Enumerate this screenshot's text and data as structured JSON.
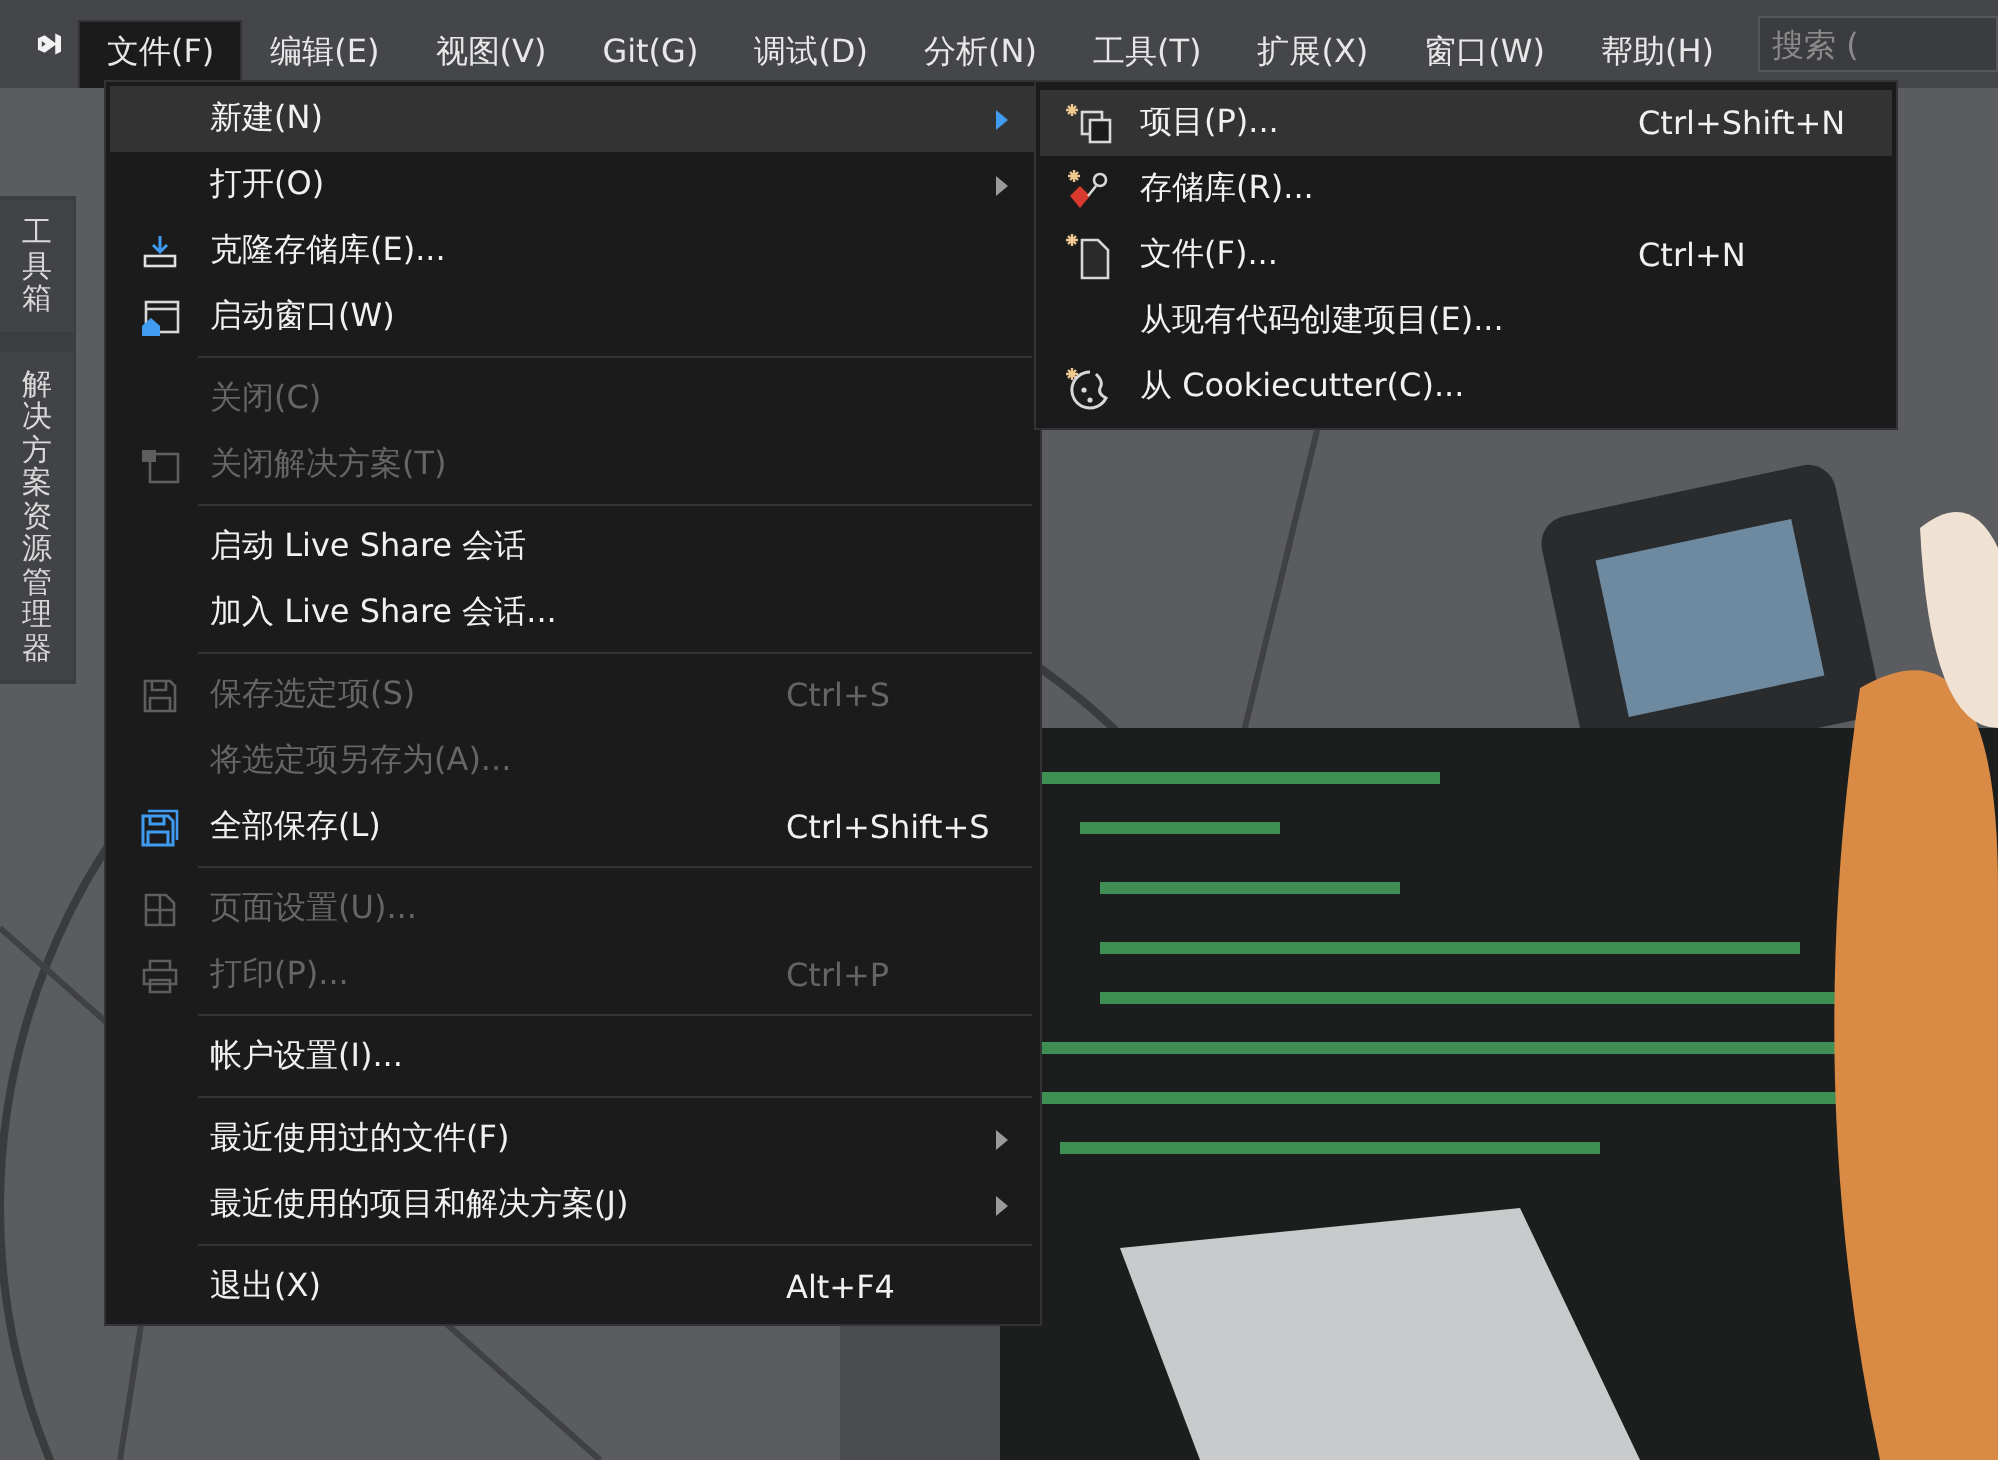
{
  "menu_bar": {
    "items": [
      {
        "label": "文件(F)",
        "selected": true
      },
      {
        "label": "编辑(E)",
        "selected": false
      },
      {
        "label": "视图(V)",
        "selected": false
      },
      {
        "label": "Git(G)",
        "selected": false
      },
      {
        "label": "调试(D)",
        "selected": false
      },
      {
        "label": "分析(N)",
        "selected": false
      },
      {
        "label": "工具(T)",
        "selected": false
      },
      {
        "label": "扩展(X)",
        "selected": false
      },
      {
        "label": "窗口(W)",
        "selected": false
      },
      {
        "label": "帮助(H)",
        "selected": false
      }
    ],
    "search": {
      "placeholder": "搜索 ("
    }
  },
  "side_tabs": [
    "工具箱",
    "解决方案资源管理器"
  ],
  "file_menu": {
    "items": [
      {
        "kind": "item",
        "label": "新建(N)",
        "selected": true,
        "disabled": false,
        "submenu": true
      },
      {
        "kind": "item",
        "label": "打开(O)",
        "selected": false,
        "disabled": false,
        "submenu": true
      },
      {
        "kind": "item",
        "label": "克隆存储库(E)...",
        "selected": false,
        "disabled": false,
        "submenu": false
      },
      {
        "kind": "item",
        "label": "启动窗口(W)",
        "selected": false,
        "disabled": false,
        "submenu": false
      },
      {
        "kind": "separator"
      },
      {
        "kind": "item",
        "label": "关闭(C)",
        "selected": false,
        "disabled": true,
        "submenu": false
      },
      {
        "kind": "item",
        "label": "关闭解决方案(T)",
        "selected": false,
        "disabled": true,
        "submenu": false
      },
      {
        "kind": "separator"
      },
      {
        "kind": "item",
        "label": "启动 Live Share 会话",
        "selected": false,
        "disabled": false,
        "submenu": false
      },
      {
        "kind": "item",
        "label": "加入 Live Share 会话...",
        "selected": false,
        "disabled": false,
        "submenu": false
      },
      {
        "kind": "separator"
      },
      {
        "kind": "item",
        "label": "保存选定项(S)",
        "shortcut": "Ctrl+S",
        "selected": false,
        "disabled": true,
        "submenu": false
      },
      {
        "kind": "item",
        "label": "将选定项另存为(A)...",
        "selected": false,
        "disabled": true,
        "submenu": false
      },
      {
        "kind": "item",
        "label": "全部保存(L)",
        "shortcut": "Ctrl+Shift+S",
        "selected": false,
        "disabled": false,
        "submenu": false
      },
      {
        "kind": "separator"
      },
      {
        "kind": "item",
        "label": "页面设置(U)...",
        "selected": false,
        "disabled": true,
        "submenu": false
      },
      {
        "kind": "item",
        "label": "打印(P)...",
        "shortcut": "Ctrl+P",
        "selected": false,
        "disabled": true,
        "submenu": false
      },
      {
        "kind": "separator"
      },
      {
        "kind": "item",
        "label": "帐户设置(I)...",
        "selected": false,
        "disabled": false,
        "submenu": false
      },
      {
        "kind": "separator"
      },
      {
        "kind": "item",
        "label": "最近使用过的文件(F)",
        "selected": false,
        "disabled": false,
        "submenu": true
      },
      {
        "kind": "item",
        "label": "最近使用的项目和解决方案(J)",
        "selected": false,
        "disabled": false,
        "submenu": true
      },
      {
        "kind": "separator"
      },
      {
        "kind": "item",
        "label": "退出(X)",
        "shortcut": "Alt+F4",
        "selected": false,
        "disabled": false,
        "submenu": false
      }
    ]
  },
  "new_submenu": {
    "items": [
      {
        "label": "项目(P)...",
        "shortcut": "Ctrl+Shift+N",
        "selected": true
      },
      {
        "label": "存储库(R)...",
        "selected": false
      },
      {
        "label": "文件(F)...",
        "shortcut": "Ctrl+N",
        "selected": false
      },
      {
        "label": "从现有代码创建项目(E)...",
        "selected": false
      },
      {
        "label": "从 Cookiecutter(C)...",
        "selected": false
      }
    ]
  }
}
